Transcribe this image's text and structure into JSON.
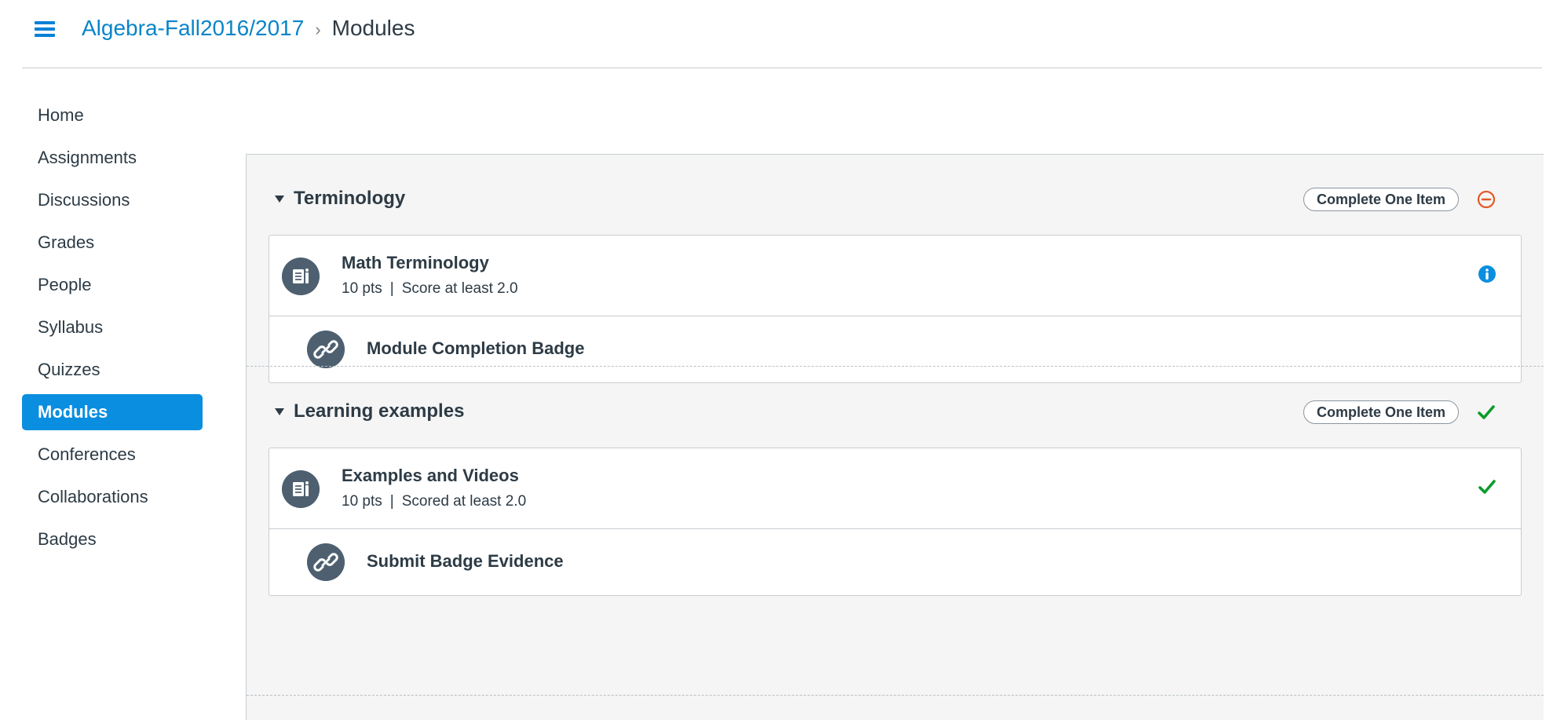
{
  "header": {
    "course_link": "Algebra-Fall2016/2017",
    "separator": "›",
    "current_page": "Modules"
  },
  "nav": {
    "items": [
      {
        "label": "Home"
      },
      {
        "label": "Assignments"
      },
      {
        "label": "Discussions"
      },
      {
        "label": "Grades"
      },
      {
        "label": "People"
      },
      {
        "label": "Syllabus"
      },
      {
        "label": "Quizzes"
      },
      {
        "label": "Modules",
        "active": true
      },
      {
        "label": "Conferences"
      },
      {
        "label": "Collaborations"
      },
      {
        "label": "Badges"
      }
    ]
  },
  "modules": [
    {
      "title": "Terminology",
      "requirement": "Complete One Item",
      "status_icon": "minus-circle-icon",
      "items": [
        {
          "title": "Math Terminology",
          "points": "10 pts",
          "pipe": "|",
          "criteria": "Score at least 2.0",
          "status_icon": "info-icon"
        },
        {
          "title": "Module Completion Badge",
          "indented": true
        }
      ]
    },
    {
      "title": "Learning examples",
      "requirement": "Complete One Item",
      "status_icon": "check-icon",
      "items": [
        {
          "title": "Examples and Videos",
          "points": "10 pts",
          "pipe": "|",
          "criteria": "Scored at least 2.0",
          "status_icon": "check-icon"
        },
        {
          "title": "Submit Badge Evidence",
          "indented": true
        }
      ]
    }
  ],
  "colors": {
    "brand_blue": "#0a8ee0",
    "link_blue": "#0a84c9",
    "incomplete_orange": "#e35927",
    "complete_green": "#0b9b2a",
    "info_blue": "#0a8ee0",
    "icon_slate": "#4e6070"
  }
}
